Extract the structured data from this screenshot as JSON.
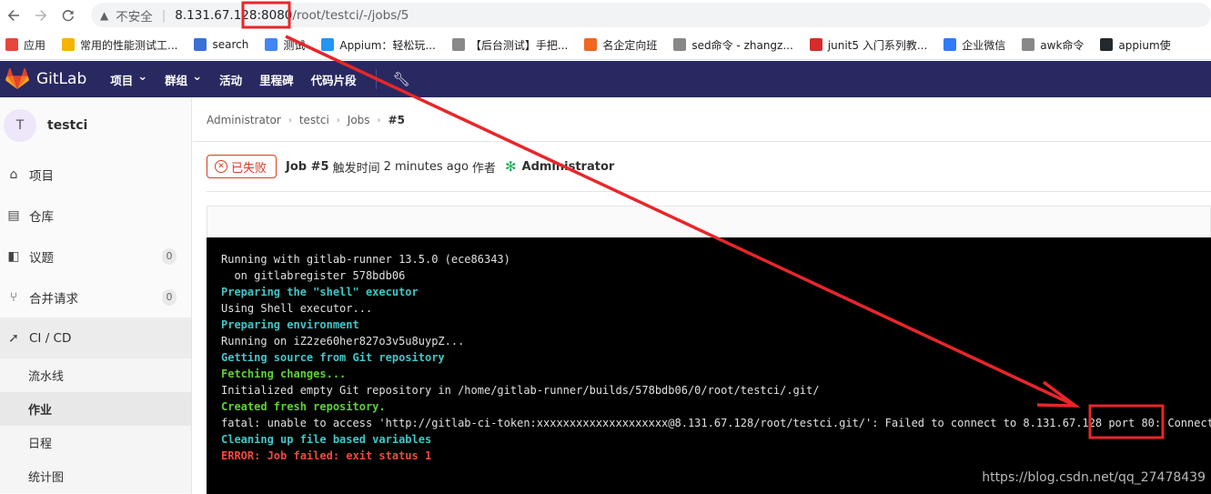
{
  "browser": {
    "security_label": "不安全",
    "url_host": "8.131.67.12",
    "url_host_tail": "8",
    "url_port": ":8080",
    "url_path": "/root/testci/-/jobs/5"
  },
  "bookmarks": [
    {
      "label": "应用",
      "icon": "apps-grid-icon",
      "color": "#e8453c"
    },
    {
      "label": "常用的性能测试工...",
      "icon": "bookmark-yellow-icon",
      "color": "#f4b400"
    },
    {
      "label": "search",
      "icon": "paw-icon",
      "color": "#3b6fd6"
    },
    {
      "label": "测试",
      "icon": "bookmark-blue-icon",
      "color": "#4285f4"
    },
    {
      "label": "Appium：轻松玩...",
      "icon": "cloud-icon",
      "color": "#2196f3"
    },
    {
      "label": "【后台测试】手把...",
      "icon": "pen-icon",
      "color": "#888888"
    },
    {
      "label": "名企定向班",
      "icon": "orange-mark-icon",
      "color": "#f26522"
    },
    {
      "label": "sed命令 - zhangz...",
      "icon": "pen-icon",
      "color": "#888888"
    },
    {
      "label": "junit5 入门系列教...",
      "icon": "csdn-icon",
      "color": "#d52b2b"
    },
    {
      "label": "企业微信",
      "icon": "wecom-icon",
      "color": "#2e7cf6"
    },
    {
      "label": "awk命令",
      "icon": "pen-icon",
      "color": "#888888"
    },
    {
      "label": "appium使",
      "icon": "github-icon",
      "color": "#24292e"
    }
  ],
  "gitlab_nav": {
    "brand": "GitLab",
    "items": [
      {
        "label": "项目",
        "dropdown": true
      },
      {
        "label": "群组",
        "dropdown": true
      },
      {
        "label": "活动",
        "dropdown": false
      },
      {
        "label": "里程碑",
        "dropdown": false
      },
      {
        "label": "代码片段",
        "dropdown": false
      }
    ]
  },
  "sidebar": {
    "avatar_letter": "T",
    "project_name": "testci",
    "items": [
      {
        "label": "项目",
        "icon": "home-icon"
      },
      {
        "label": "仓库",
        "icon": "doc-icon"
      },
      {
        "label": "议题",
        "icon": "issues-icon",
        "count": "0"
      },
      {
        "label": "合并请求",
        "icon": "merge-request-icon",
        "count": "0"
      }
    ],
    "cicd": {
      "label": "CI / CD",
      "icon": "rocket-icon",
      "sub_items": [
        "流水线",
        "作业",
        "日程",
        "统计图"
      ],
      "active": "作业"
    }
  },
  "breadcrumb": [
    "Administrator",
    "testci",
    "Jobs",
    "#5"
  ],
  "job_header": {
    "status": "已失败",
    "status_color": "#db3b21",
    "job": "Job #5",
    "triggered_text": "触发时间",
    "time_ago": "2 minutes ago",
    "by_text": "作者",
    "author": "Administrator"
  },
  "log_lines": [
    {
      "text": "Running with gitlab-runner 13.5.0 (ece86343)",
      "style": "white"
    },
    {
      "text": "  on gitlabregister 578bdb06",
      "style": "white"
    },
    {
      "text": "Preparing the \"shell\" executor",
      "style": "cyan"
    },
    {
      "text": "Using Shell executor...",
      "style": "white"
    },
    {
      "text": "Preparing environment",
      "style": "cyan"
    },
    {
      "text": "Running on iZ2ze60her827o3v5u8uypZ...",
      "style": "white"
    },
    {
      "text": "Getting source from Git repository",
      "style": "cyan"
    },
    {
      "text": "Fetching changes...",
      "style": "green"
    },
    {
      "text": "Initialized empty Git repository in /home/gitlab-runner/builds/578bdb06/0/root/testci/.git/",
      "style": "white"
    },
    {
      "text": "Created fresh repository.",
      "style": "green"
    },
    {
      "text": "fatal: unable to access 'http://gitlab-ci-token:xxxxxxxxxxxxxxxxxxxx@8.131.67.128/root/testci.git/': Failed to connect to 8.131.67.128 port 80: Connect",
      "style": "white"
    },
    {
      "text": "Cleaning up file based variables",
      "style": "cyan"
    },
    {
      "text": "ERROR: Job failed: exit status 1",
      "style": "red"
    }
  ],
  "watermark": "https://blog.csdn.net/qq_27478439",
  "annotation_color": "#e8262a"
}
